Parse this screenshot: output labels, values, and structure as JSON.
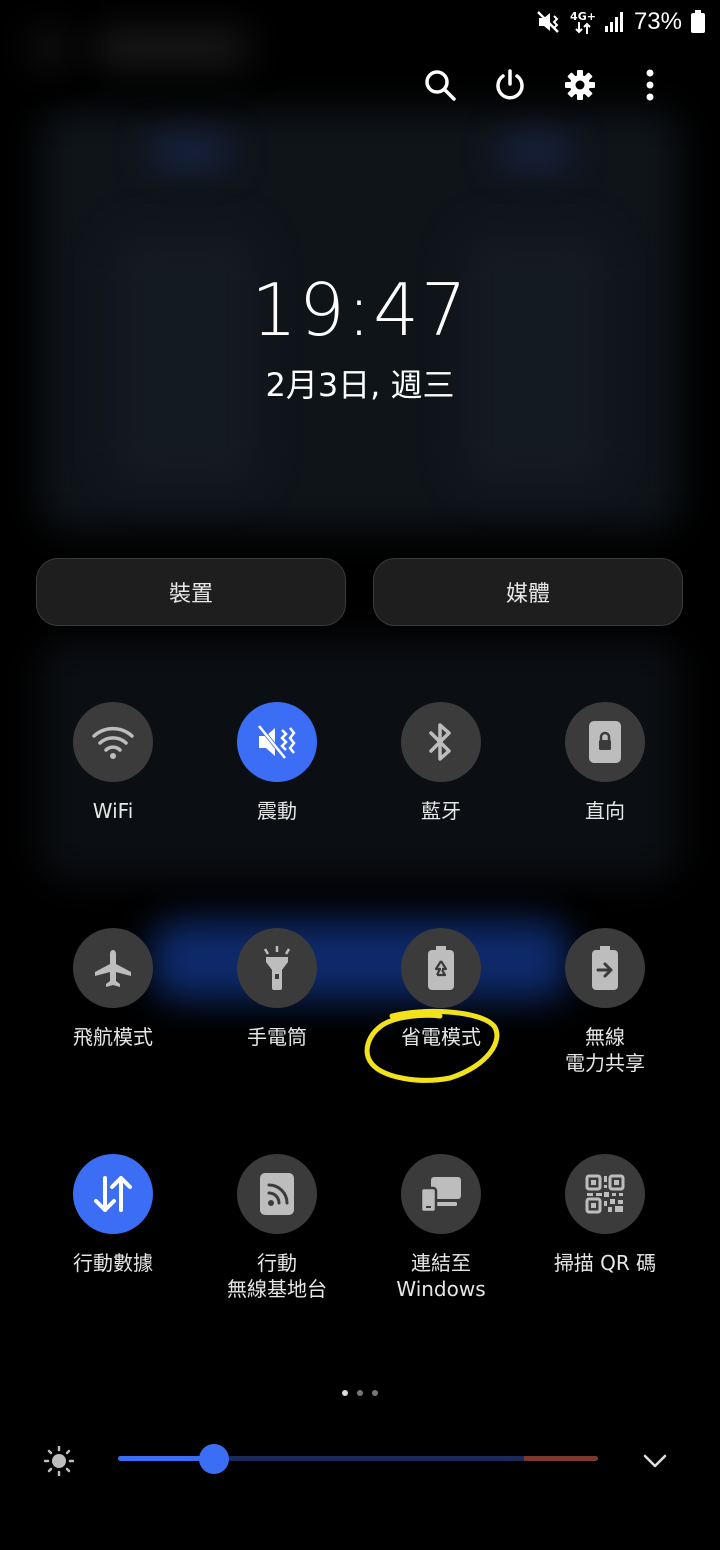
{
  "status_bar": {
    "network": "4G+",
    "battery_percent": "73%",
    "icons": [
      "mute-vibrate-icon",
      "lte-signal-icon",
      "signal-bars-icon",
      "battery-icon"
    ]
  },
  "top_actions": [
    "search-icon",
    "power-icon",
    "gear-icon",
    "more-vert-icon"
  ],
  "clock": {
    "time": "19:47",
    "date": "2月3日, 週三"
  },
  "buttons": {
    "devices": "裝置",
    "media": "媒體"
  },
  "tiles": [
    {
      "label": "WiFi",
      "icon": "wifi-icon",
      "on": false
    },
    {
      "label": "震動",
      "icon": "vibrate-icon",
      "on": true
    },
    {
      "label": "藍牙",
      "icon": "bluetooth-icon",
      "on": false
    },
    {
      "label": "直向",
      "icon": "portrait-lock-icon",
      "on": false
    },
    {
      "label": "飛航模式",
      "icon": "airplane-icon",
      "on": false
    },
    {
      "label": "手電筒",
      "icon": "flashlight-icon",
      "on": false
    },
    {
      "label": "省電模式",
      "icon": "power-saving-icon",
      "on": false
    },
    {
      "label": "無線\n電力共享",
      "icon": "wireless-powershare-icon",
      "on": false
    },
    {
      "label": "行動數據",
      "icon": "mobile-data-icon",
      "on": true
    },
    {
      "label": "行動\n無線基地台",
      "icon": "hotspot-icon",
      "on": false
    },
    {
      "label": "連結至\nWindows",
      "icon": "link-windows-icon",
      "on": false
    },
    {
      "label": "掃描 QR 碼",
      "icon": "qr-code-icon",
      "on": false
    }
  ],
  "pagination": {
    "pages": 3,
    "current": 1
  },
  "brightness": {
    "level": 0.2
  },
  "colors": {
    "accent": "#3b6ef5",
    "tile_off": "#3b3b3b",
    "annotation": "#f2e21c"
  }
}
